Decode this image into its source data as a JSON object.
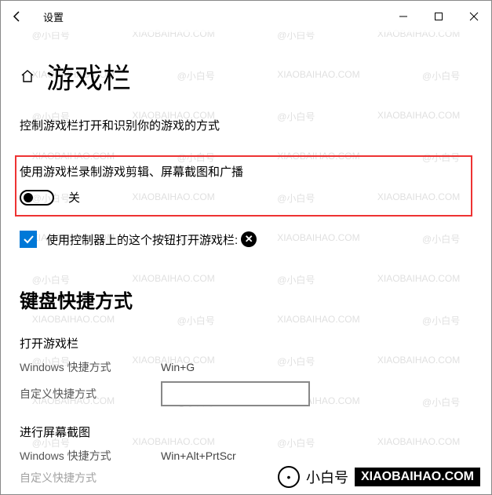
{
  "titlebar": {
    "app_name": "设置"
  },
  "page": {
    "title": "游戏栏",
    "desc": "控制游戏栏打开和识别你的游戏的方式"
  },
  "record_toggle": {
    "label": "使用游戏栏录制游戏剪辑、屏幕截图和广播",
    "state": "关"
  },
  "controller_checkbox": {
    "label": "使用控制器上的这个按钮打开游戏栏:",
    "checked": true
  },
  "shortcuts": {
    "section_title": "键盘快捷方式",
    "open_bar": {
      "label": "打开游戏栏",
      "win_label": "Windows 快捷方式",
      "win_value": "Win+G",
      "custom_label": "自定义快捷方式"
    },
    "screenshot": {
      "label": "进行屏幕截图",
      "win_label": "Windows 快捷方式",
      "win_value": "Win+Alt+PrtScr",
      "custom_label": "自定义快捷方式"
    }
  },
  "watermark": {
    "name": "@小白号",
    "url": "XIAOBAIHAO.COM"
  },
  "branding": {
    "name": "小白号",
    "url": "XIAOBAIHAO.COM"
  }
}
